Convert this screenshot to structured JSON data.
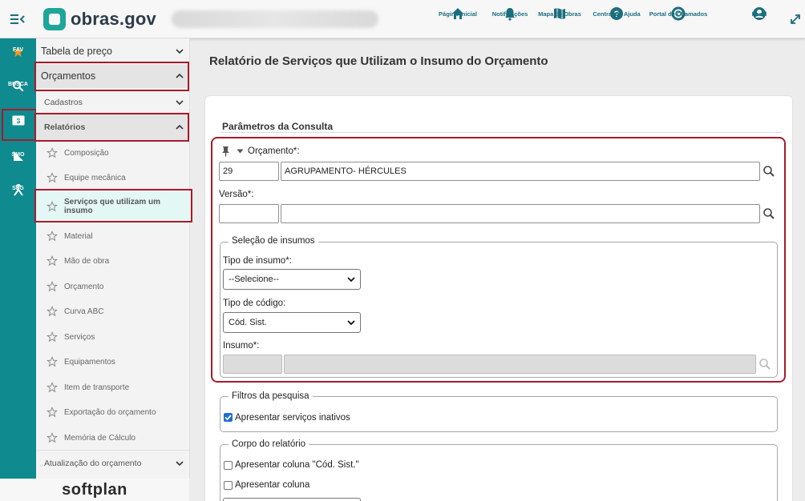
{
  "header": {
    "brand": "obras.gov",
    "nav": [
      {
        "label": "Página inicial",
        "icon": "home-icon"
      },
      {
        "label": "Notificações",
        "icon": "bell-icon"
      },
      {
        "label": "Mapa de Obras",
        "icon": "map-icon"
      },
      {
        "label": "Central de Ajuda",
        "icon": "help-icon"
      },
      {
        "label": "Portal de Chamados",
        "icon": "lifebuoy-icon"
      },
      {
        "label": "Perfil",
        "icon": "user-icon"
      }
    ]
  },
  "rail": {
    "items": [
      {
        "label": "FAV",
        "icon": "star-icon"
      },
      {
        "label": "BUSCA",
        "icon": "search-icon"
      },
      {
        "label": "SCO",
        "icon": "sco-icon"
      },
      {
        "label": "SMO",
        "icon": "ruler-icon"
      },
      {
        "label": "SEG",
        "icon": "merge-icon"
      }
    ],
    "footer_brand": "softplan"
  },
  "sidebar": {
    "tabela": "Tabela de preço",
    "orcamentos": "Orçamentos",
    "cadastros": "Cadastros",
    "relatorios": "Relatórios",
    "leaves": [
      "Composição",
      "Equipe mecânica",
      "Serviços que utilizam um insumo",
      "Material",
      "Mão de obra",
      "Orçamento",
      "Curva ABC",
      "Serviços",
      "Equipamentos",
      "Item de transporte",
      "Exportação do orçamento",
      "Memória de Cálculo"
    ],
    "atualizacao": "Atualização do orçamento"
  },
  "main": {
    "title": "Relatório de Serviços que Utilizam o Insumo do Orçamento",
    "section_title": "Parâmetros da Consulta",
    "orcamento_label": "Orçamento*:",
    "orcamento_code": "29",
    "orcamento_name": "AGRUPAMENTO- HÉRCULES",
    "versao_label": "Versão*:",
    "versao_code": "",
    "versao_name": "",
    "selecao_legend": "Seleção de insumos",
    "tipo_insumo_label": "Tipo de insumo*:",
    "tipo_insumo_value": "--Selecione--",
    "tipo_codigo_label": "Tipo de código:",
    "tipo_codigo_value": "Cód. Sist.",
    "insumo_label": "Insumo*:",
    "filtros_legend": "Filtros da pesquisa",
    "inativos_label": "Apresentar serviços inativos",
    "inativos_checked": true,
    "corpo_legend": "Corpo do relatório",
    "col_cod_label": "Apresentar coluna \"Cód. Sist.\"",
    "col_label": "Apresentar coluna"
  },
  "colors": {
    "teal": "#0f8a8f",
    "highlight_red": "#a51c2c",
    "nav_text": "#1b6e7d"
  }
}
